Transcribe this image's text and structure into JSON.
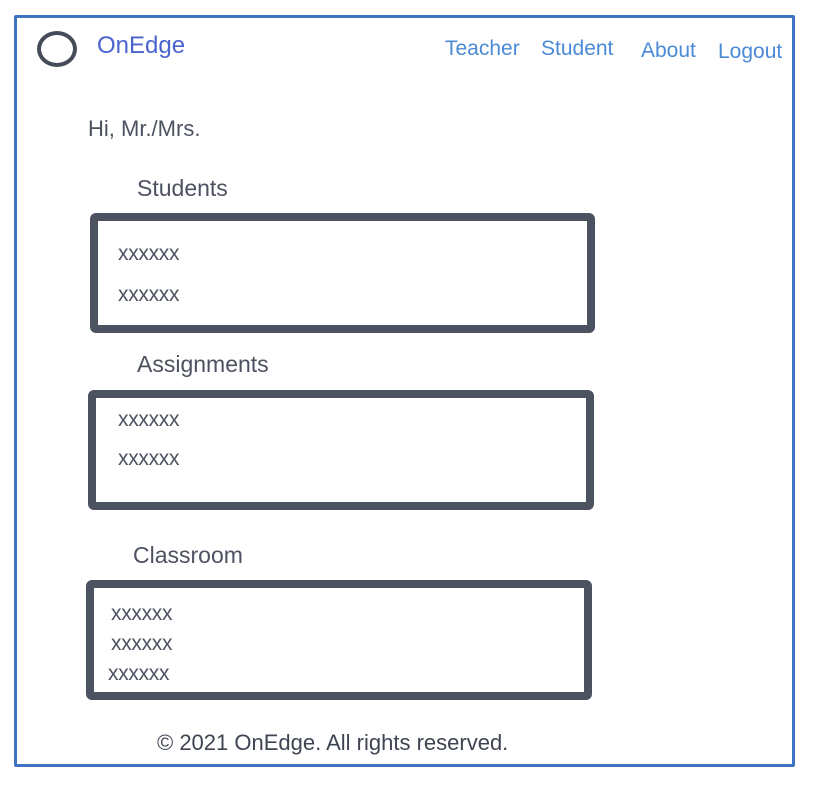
{
  "header": {
    "brand": "OnEdge",
    "nav": [
      "Teacher",
      "Student",
      "About",
      "Logout"
    ]
  },
  "greeting": "Hi, Mr./Mrs.",
  "sections": [
    {
      "title": "Students",
      "items": [
        "xxxxxx",
        "xxxxxx"
      ]
    },
    {
      "title": "Assignments",
      "items": [
        "xxxxxx",
        "xxxxxx"
      ]
    },
    {
      "title": "Classroom",
      "items": [
        "xxxxxx",
        "xxxxxx",
        "xxxxxx"
      ]
    }
  ],
  "footer": {
    "text": "© 2021 OnEdge. All rights reserved."
  },
  "colors": {
    "frame_border": "#3f73c4",
    "brand": "#4a63cf",
    "nav_link": "#4a8ad6",
    "box_border": "#4d5261",
    "text": "#4d5261"
  },
  "icons": {
    "logo": "circle-logo-icon"
  }
}
